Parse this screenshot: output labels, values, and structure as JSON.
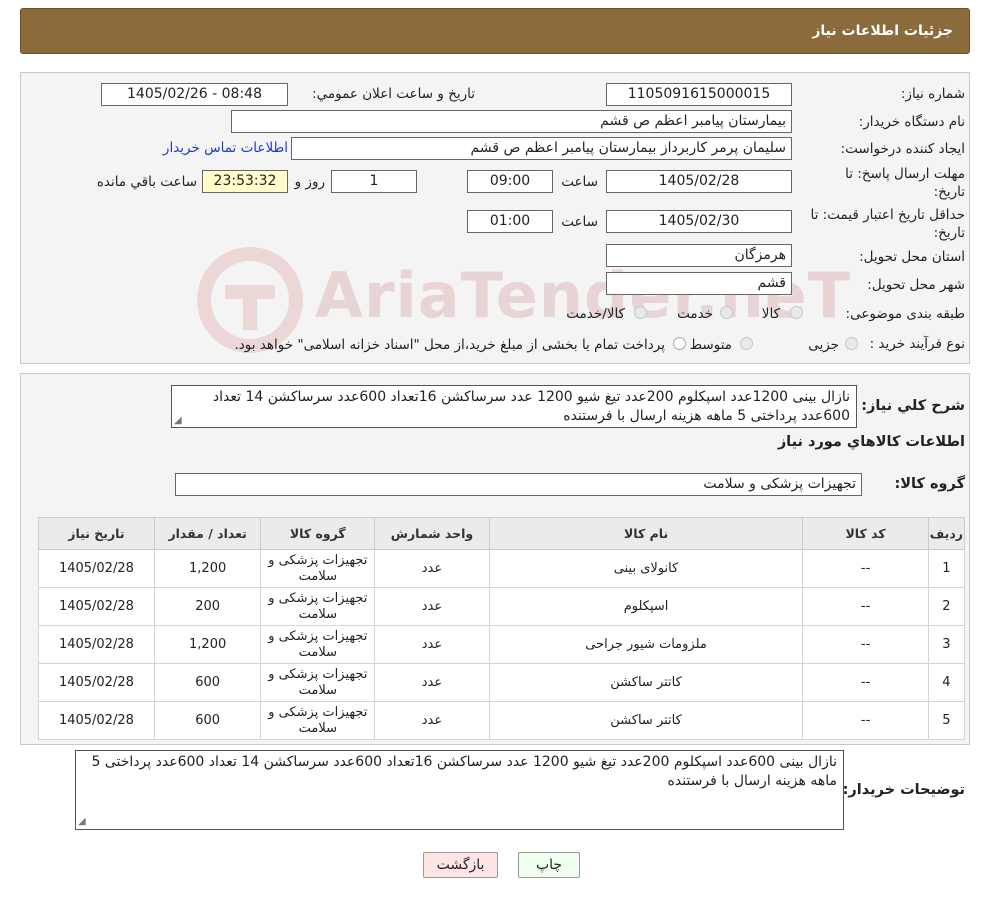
{
  "header": {
    "title": "جزئیات اطلاعات نیاز"
  },
  "watermark": {
    "text": "AriaTender.neT"
  },
  "fields": {
    "need_number_label": "شماره نیاز:",
    "need_number": "1105091615000015",
    "announce_label": "تاریخ و ساعت اعلان عمومي:",
    "announce_value": "1405/02/26 - 08:48",
    "buyer_org_label": "نام دستگاه خریدار:",
    "buyer_org": "بیمارستان پیامبر اعظم  ص  قشم",
    "creator_label": "ایجاد کننده درخواست:",
    "creator": "سلیمان پرمر کاربرداز بیمارستان پیامبر اعظم  ص  قشم",
    "contact_link": "اطلاعات تماس خریدار",
    "deadline_label_1": "مهلت ارسال پاسخ: تا",
    "deadline_label_2": "تاریخ:",
    "deadline_date": "1405/02/28",
    "time_label": "ساعت",
    "deadline_time": "09:00",
    "days_value": "1",
    "days_label": "روز و",
    "remaining_time": "23:53:32",
    "remaining_label": "ساعت باقي مانده",
    "validity_label_1": "حداقل تاریخ اعتبار قیمت: تا",
    "validity_label_2": "تاریخ:",
    "validity_date": "1405/02/30",
    "validity_time": "01:00",
    "province_label": "استان محل تحویل:",
    "province": "هرمزگان",
    "city_label": "شهر محل تحویل:",
    "city": "قشم",
    "category_label": "طبقه بندی موضوعی:",
    "category_options": [
      "کالا",
      "خدمت",
      "کالا/خدمت"
    ],
    "process_label": "نوع فرآیند خرید :",
    "process_options": [
      "جزیی",
      "متوسط"
    ],
    "process_note": "پرداخت تمام یا بخشی از مبلغ خرید،از محل \"اسناد خزانه اسلامی\" خواهد بود."
  },
  "summary": {
    "label": "شرح کلي نیاز:",
    "text": "نازال بینی 1200عدد اسپکلوم 200عدد تیغ شیو 1200 عدد سرساکشن 16تعداد 600عدد سرساکشن 14 تعداد 600عدد پرداختی 5 ماهه هزینه ارسال با فرستنده"
  },
  "goods": {
    "section_title": "اطلاعات کالاهاي مورد نیاز",
    "group_label": "گروه کالا:",
    "group_value": "تجهیزات پزشکی و سلامت",
    "columns": [
      "ردیف",
      "کد کالا",
      "نام کالا",
      "واحد شمارش",
      "گروه کالا",
      "تعداد / مقدار",
      "تاریخ نیاز"
    ],
    "rows": [
      [
        "1",
        "--",
        "کانولای بینی",
        "عدد",
        "تجهیزات پزشکی و سلامت",
        "1,200",
        "1405/02/28"
      ],
      [
        "2",
        "--",
        "اسپکلوم",
        "عدد",
        "تجهیزات پزشکی و سلامت",
        "200",
        "1405/02/28"
      ],
      [
        "3",
        "--",
        "ملزومات شیور جراحی",
        "عدد",
        "تجهیزات پزشکی و سلامت",
        "1,200",
        "1405/02/28"
      ],
      [
        "4",
        "--",
        "کاتتر ساکشن",
        "عدد",
        "تجهیزات پزشکی و سلامت",
        "600",
        "1405/02/28"
      ],
      [
        "5",
        "--",
        "کاتتر ساکشن",
        "عدد",
        "تجهیزات پزشکی و سلامت",
        "600",
        "1405/02/28"
      ]
    ]
  },
  "buyer_notes": {
    "label": "توضیحات خریدار:",
    "text": "نازال بینی 600عدد اسپکلوم 200عدد تیغ شیو 1200 عدد سرساکشن 16تعداد 600عدد سرساکشن 14 تعداد 600عدد پرداختی 5 ماهه هزینه ارسال با فرستنده"
  },
  "buttons": {
    "print": "چاپ",
    "back": "بازگشت"
  }
}
